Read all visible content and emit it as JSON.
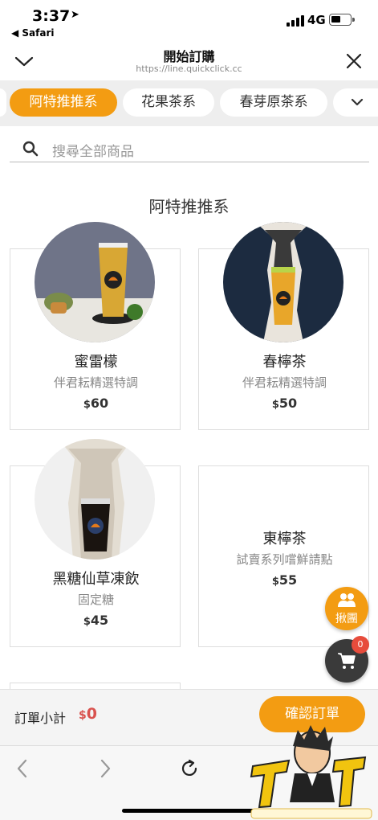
{
  "status_bar": {
    "time": "3:37",
    "back_app": "◀ Safari",
    "network": "4G"
  },
  "header": {
    "title": "開始訂購",
    "url": "https://line.quickclick.cc"
  },
  "categories": [
    {
      "label": "阿特推推系",
      "active": true
    },
    {
      "label": "花果茶系",
      "active": false
    },
    {
      "label": "春芽原茶系",
      "active": false
    }
  ],
  "search": {
    "placeholder": "搜尋全部商品"
  },
  "section": {
    "title": "阿特推推系"
  },
  "products": [
    {
      "name": "蜜雷檬",
      "desc": "伴君耘精選特調",
      "currency": "$",
      "price": "60",
      "has_image": true
    },
    {
      "name": "春檸茶",
      "desc": "伴君耘精選特調",
      "currency": "$",
      "price": "50",
      "has_image": true
    },
    {
      "name": "黑糖仙草凍飲",
      "desc": "固定糖",
      "currency": "$",
      "price": "45",
      "has_image": true
    },
    {
      "name": "東檸茶",
      "desc": "試賣系列嚐鮮請點",
      "currency": "$",
      "price": "55",
      "has_image": false
    }
  ],
  "group_button": {
    "label": "揪團"
  },
  "cart": {
    "count": "0"
  },
  "footer": {
    "subtotal_label": "訂單小計",
    "currency": "$",
    "subtotal_value": "0",
    "confirm_label": "確認訂單"
  },
  "colors": {
    "accent": "#f39c12",
    "price_red": "#d9534f",
    "cart_dark": "#3a3a3a"
  }
}
